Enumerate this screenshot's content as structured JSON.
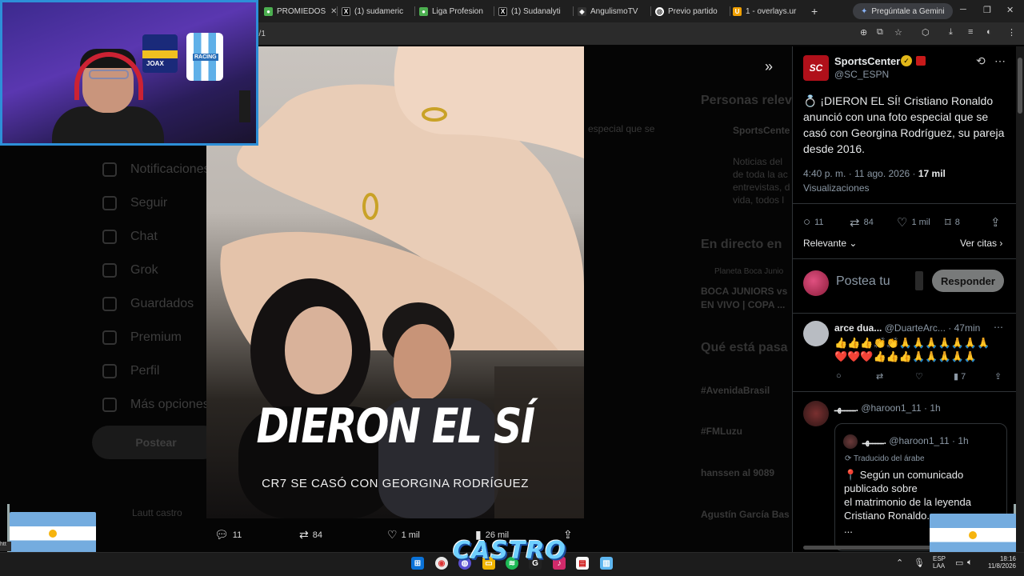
{
  "browser": {
    "tabs": [
      {
        "label": "PROMIEDOS",
        "icon": "promiedos-icon",
        "color": "#4caf50"
      },
      {
        "label": "(1) sudameric",
        "icon": "x-icon",
        "color": "#000000"
      },
      {
        "label": "Liga Profesion",
        "icon": "soccer-icon",
        "color": "#4caf50"
      },
      {
        "label": "(1) Sudanalyti",
        "icon": "x-icon",
        "color": "#000000"
      },
      {
        "label": "AngulismoTV",
        "icon": "angulismo-icon",
        "color": "#ffffff"
      },
      {
        "label": "Previo partido",
        "icon": "chatgpt-icon",
        "color": "#ffffff"
      },
      {
        "label": "1 - overlays.ur",
        "icon": "overlays-icon",
        "color": "#f0a000"
      }
    ],
    "gemini_label": "Pregúntale a Gemini",
    "url": "o/1"
  },
  "x_nav": {
    "items": [
      "Notificaciones",
      "Seguir",
      "Chat",
      "Grok",
      "Guardados",
      "Premium",
      "Perfil",
      "Más opciones"
    ],
    "post_label": "Postear",
    "account": "Lautt castro"
  },
  "x_sidebar_dim": {
    "relevant_heading": "Personas relev",
    "relevant_name": "SportsCente",
    "relevant_bio": [
      "Noticias del",
      "de toda la ac",
      "entrevistas, d",
      "vida, todos l"
    ],
    "live_heading": "En directo en",
    "live_account": "Planeta Boca Junio",
    "live_title": [
      "BOCA JUNIORS vs",
      "EN VIVO | COPA ..."
    ],
    "trending_heading": "Qué está pasa",
    "trends": [
      "#AvenidaBrasil",
      "#FMLuzu",
      "hanssen al 9089",
      "Agustín García Bas"
    ],
    "partial_text": "especial que se"
  },
  "media": {
    "headline": "DIERON EL SÍ",
    "subheadline": "CR7 SE CASÓ CON GEORGINA RODRÍGUEZ",
    "replies": "11",
    "reposts": "84",
    "likes": "1 mil",
    "views": "26 mil"
  },
  "tweet": {
    "author_name": "SportsCenter",
    "author_handle": "@SC_ESPN",
    "avatar_text": "SC",
    "text": "💍 ¡DIERON EL SÍ! Cristiano Ronaldo anunció con una foto especial que se casó con Georgina Rodríguez, su pareja desde 2016.",
    "time": "4:40 p. m. · 11 ago. 2026 · ",
    "views_count": "17 mil",
    "views_label": "Visualizaciones",
    "replies": "11",
    "reposts": "84",
    "likes": "1 mil",
    "bookmarks": "8",
    "sort_label": "Relevante",
    "quotes_label": "Ver citas",
    "reply_placeholder": "Postea tu",
    "reply_button": "Responder"
  },
  "replies": [
    {
      "name": "arce dua...",
      "handle": "@DuarteArc...",
      "time": "· 47min",
      "line1": "👍👍👍👏👏🙏🙏🙏🙏🙏🙏🙏",
      "line2": "❤️❤️❤️👍👍👍🙏🙏🙏🙏🙏",
      "views": "7"
    },
    {
      "name": "ـــــهـ.",
      "handle": "@haroon1_11",
      "time": "· 1h",
      "quote_name": "ـــــهـ.",
      "quote_handle": "@haroon1_11",
      "quote_time": "· 1h",
      "translated_label": "Traducido del árabe",
      "quote_text": "📍 Según un comunicado publicado sobre\n el matrimonio de la leyenda Cristiano Ronaldo..\n..."
    }
  ],
  "overlay": {
    "castro_label": "CASTRO",
    "jersey_text": "RACING",
    "jersey_number": "JOAX"
  },
  "taskbar": {
    "lang": "ESP",
    "lang2": "LAA",
    "time": "18:16",
    "date": "11/8/2026"
  },
  "statusbar": "htt"
}
